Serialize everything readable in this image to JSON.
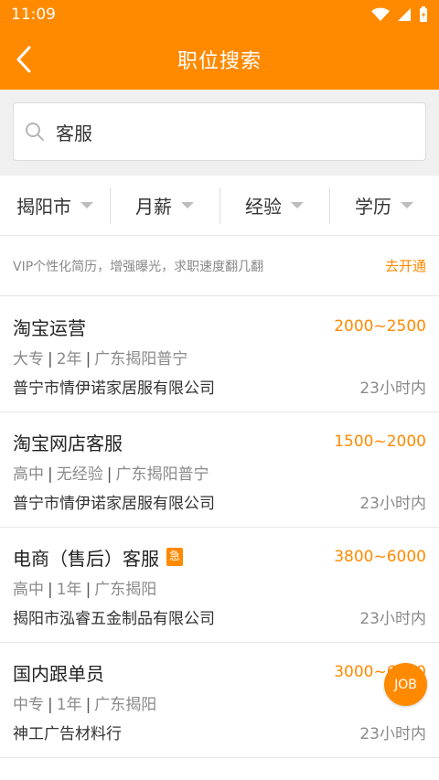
{
  "status": {
    "time": "11:09"
  },
  "header": {
    "title": "职位搜索"
  },
  "search": {
    "value": "客服"
  },
  "filters": [
    {
      "label": "揭阳市"
    },
    {
      "label": "月薪"
    },
    {
      "label": "经验"
    },
    {
      "label": "学历"
    }
  ],
  "vip": {
    "text": "VIP个性化简历，增强曝光，求职速度翻几翻",
    "link": "去开通"
  },
  "jobs": [
    {
      "title": "淘宝运营",
      "salary": "2000~2500",
      "education": "大专",
      "experience": "2年",
      "location": "广东揭阳普宁",
      "company": "普宁市情伊诺家居服有限公司",
      "time": "23小时内"
    },
    {
      "title": "淘宝网店客服",
      "salary": "1500~2000",
      "education": "高中",
      "experience": "无经验",
      "location": "广东揭阳普宁",
      "company": "普宁市情伊诺家居服有限公司",
      "time": "23小时内"
    },
    {
      "title": "电商（售后）客服",
      "badge": "急",
      "salary": "3800~6000",
      "education": "高中",
      "experience": "1年",
      "location": "广东揭阳",
      "company": "揭阳市泓睿五金制品有限公司",
      "time": "23小时内"
    },
    {
      "title": "国内跟单员",
      "salary": "3000~6000",
      "education": "中专",
      "experience": "1年",
      "location": "广东揭阳",
      "company": "神工广告材料行",
      "time": "23小时内"
    }
  ],
  "fab": {
    "label": "JOB"
  },
  "colors": {
    "accent": "#ff8a00"
  }
}
